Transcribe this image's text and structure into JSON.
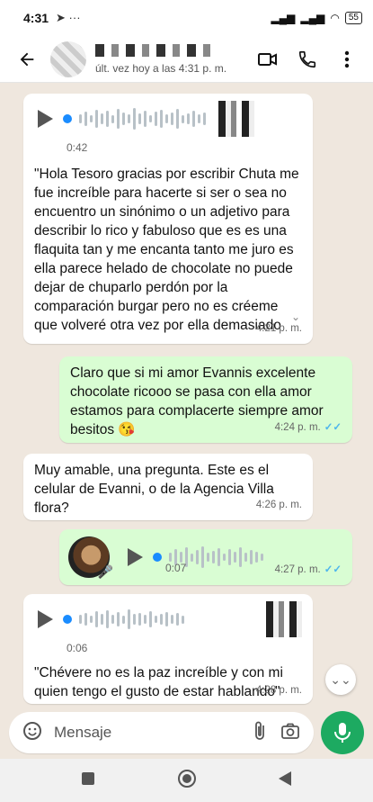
{
  "status_bar": {
    "time": "4:31",
    "battery": "55"
  },
  "header": {
    "status": "últ. vez hoy a las 4:31 p. m."
  },
  "messages": [
    {
      "type": "voice",
      "duration": "0:42"
    },
    {
      "type": "text",
      "text": "\"Hola Tesoro gracias por escribir Chuta me fue increíble para hacerte si ser o sea no encuentro un sinónimo o un adjetivo para describir lo rico y fabuloso que es es una flaquita tan y me encanta tanto me juro es ella parece helado de chocolate no puede dejar de chuparlo perdón por la comparación burgar pero no es créeme que volveré otra vez por ella demasiado rico cachas que p...",
      "time": "4:21 p. m."
    },
    {
      "type": "text",
      "text": "Claro que si mi amor Evannis excelente chocolate ricooo se pasa con ella amor estamos para complacerte siempre amor besitos 😘",
      "time": "4:24 p. m."
    },
    {
      "type": "text",
      "text": "Muy amable, una pregunta. Este es el celular de Evanni, o de la Agencia Villa flora?",
      "time": "4:26 p. m."
    },
    {
      "type": "voice",
      "duration": "0:07",
      "time": "4:27 p. m."
    },
    {
      "type": "voice",
      "duration": "0:06"
    },
    {
      "type": "text",
      "text": "\"Chévere no es la paz increíble y con mi quien tengo el gusto de estar hablando\"",
      "time": "4:28 p. m."
    }
  ],
  "composer": {
    "placeholder": "Mensaje"
  },
  "icons": {
    "back": "arrow-left-icon",
    "video": "video-call-icon",
    "call": "phone-icon",
    "menu": "more-vert-icon",
    "emoji": "emoji-icon",
    "attach": "paperclip-icon",
    "camera": "camera-icon",
    "mic": "mic-icon"
  },
  "colors": {
    "incoming": "#ffffff",
    "outgoing": "#d9fdd3",
    "accent": "#1daa61",
    "chat_bg": "#efe7de"
  }
}
